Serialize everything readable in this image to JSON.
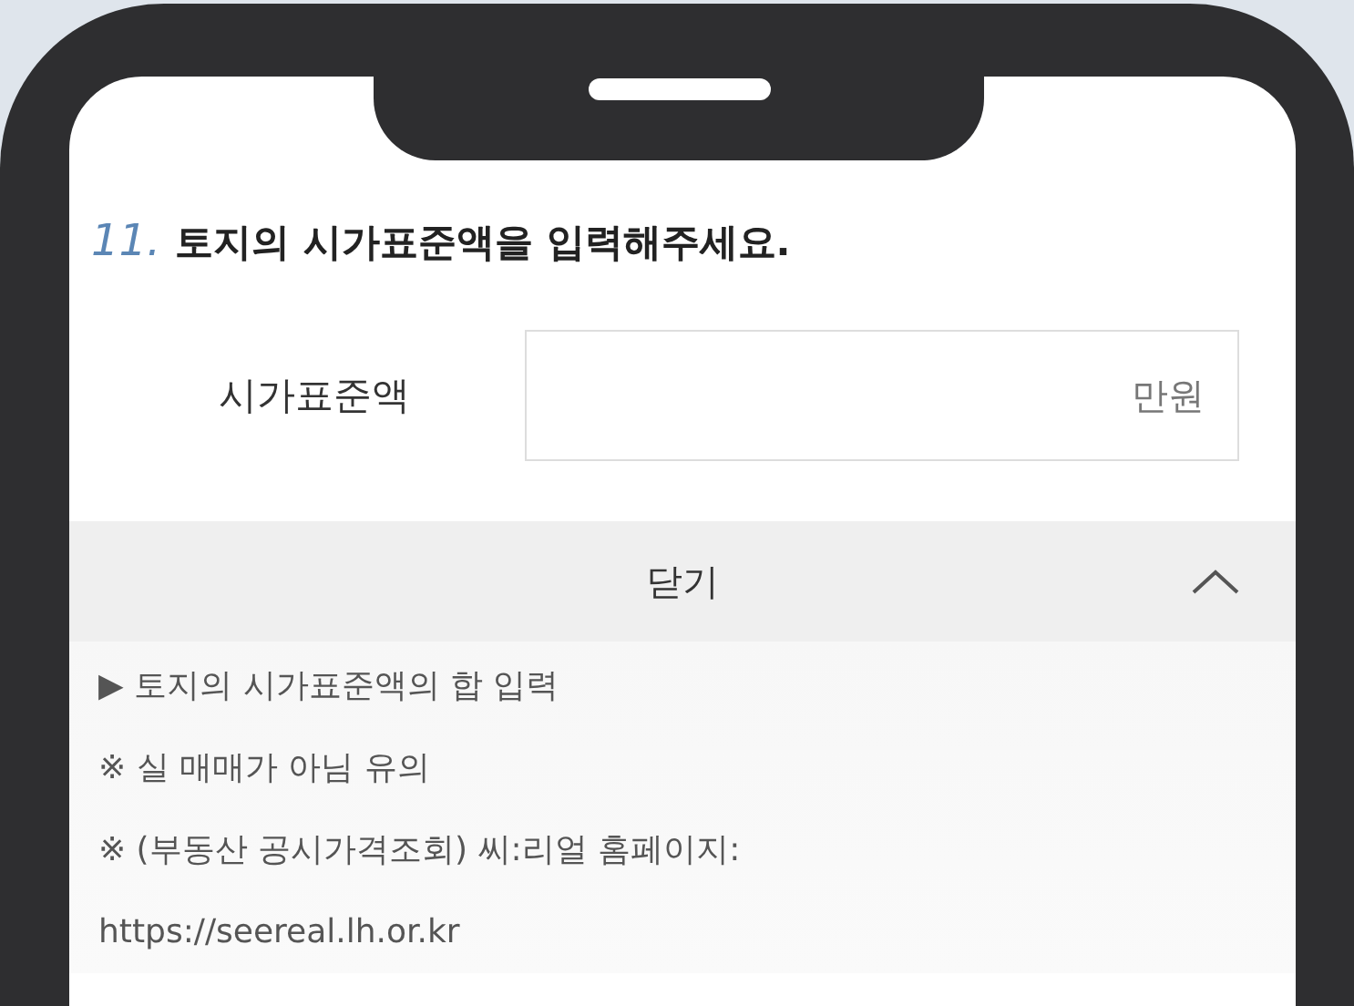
{
  "question": {
    "number": "11.",
    "text": "토지의 시가표준액을 입력해주세요."
  },
  "field": {
    "label": "시가표준액",
    "unit": "만원"
  },
  "toggle": {
    "label": "닫기",
    "expanded": true
  },
  "notes": [
    "▶ 토지의 시가표준액의 합 입력",
    "※ 실 매매가 아님 유의",
    "※ (부동산 공시가격조회) 씨:리얼 홈페이지:",
    "https://seereal.lh.or.kr"
  ]
}
